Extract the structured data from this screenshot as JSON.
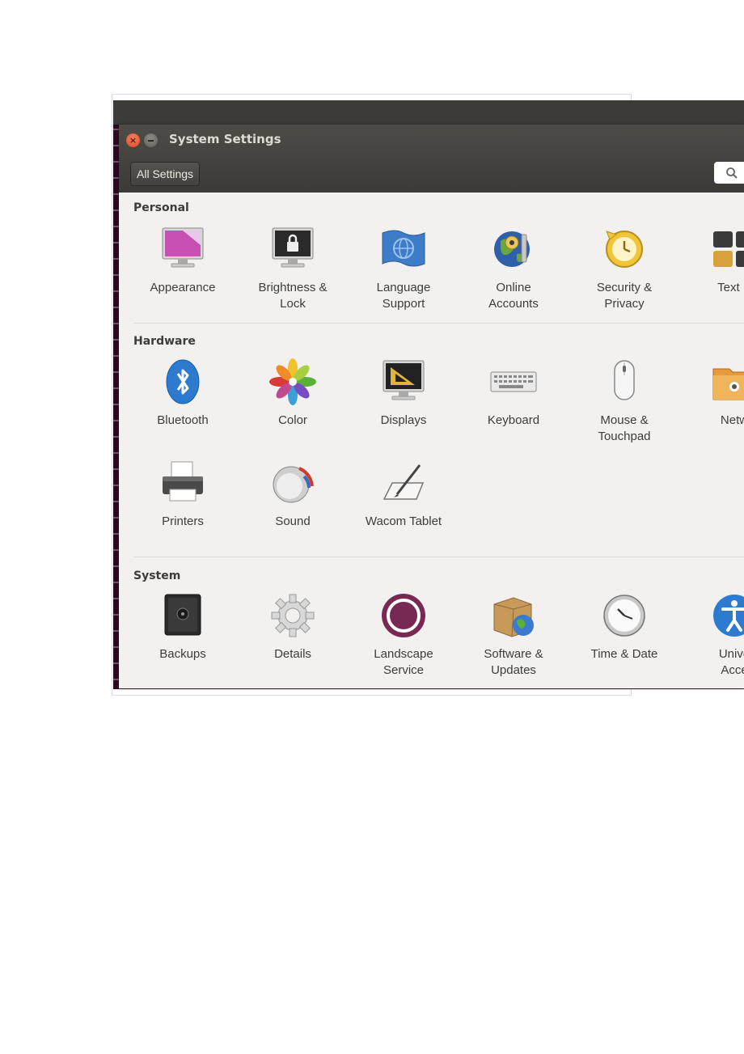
{
  "window": {
    "title": "System Settings",
    "all_settings_label": "All Settings"
  },
  "sections": [
    {
      "title": "Personal",
      "items": [
        {
          "label": "Appearance",
          "icon": "appearance-icon"
        },
        {
          "label": "Brightness &\nLock",
          "icon": "brightness-lock-icon"
        },
        {
          "label": "Language\nSupport",
          "icon": "language-support-icon"
        },
        {
          "label": "Online\nAccounts",
          "icon": "online-accounts-icon"
        },
        {
          "label": "Security &\nPrivacy",
          "icon": "security-privacy-icon"
        },
        {
          "label": "Text E",
          "icon": "text-entry-icon"
        }
      ]
    },
    {
      "title": "Hardware",
      "items": [
        {
          "label": "Bluetooth",
          "icon": "bluetooth-icon"
        },
        {
          "label": "Color",
          "icon": "color-icon"
        },
        {
          "label": "Displays",
          "icon": "displays-icon"
        },
        {
          "label": "Keyboard",
          "icon": "keyboard-icon"
        },
        {
          "label": "Mouse &\nTouchpad",
          "icon": "mouse-touchpad-icon"
        },
        {
          "label": "Netw",
          "icon": "network-icon"
        },
        {
          "label": "Printers",
          "icon": "printers-icon"
        },
        {
          "label": "Sound",
          "icon": "sound-icon"
        },
        {
          "label": "Wacom Tablet",
          "icon": "wacom-tablet-icon"
        }
      ]
    },
    {
      "title": "System",
      "items": [
        {
          "label": "Backups",
          "icon": "backups-icon"
        },
        {
          "label": "Details",
          "icon": "details-icon"
        },
        {
          "label": "Landscape\nService",
          "icon": "landscape-service-icon"
        },
        {
          "label": "Software &\nUpdates",
          "icon": "software-updates-icon"
        },
        {
          "label": "Time & Date",
          "icon": "time-date-icon"
        },
        {
          "label": "Unive\nAcce",
          "icon": "universal-access-icon"
        }
      ]
    }
  ],
  "colors": {
    "titlebar": "#3c3b37",
    "window_bg": "#f2f1f0",
    "close_button": "#df4a21",
    "desktop_bg": "#2c0a1e"
  }
}
